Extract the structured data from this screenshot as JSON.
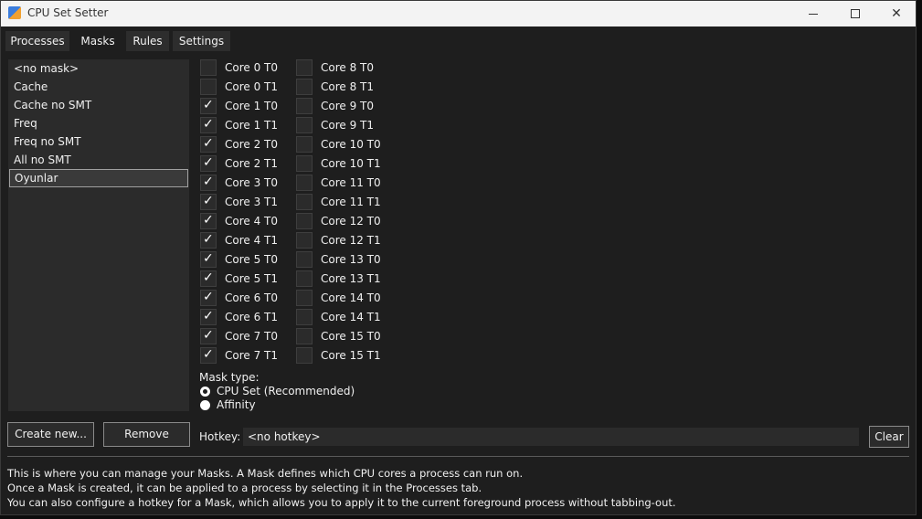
{
  "window": {
    "title": "CPU Set Setter"
  },
  "tabs": [
    "Processes",
    "Masks",
    "Rules",
    "Settings"
  ],
  "masks": [
    "<no mask>",
    "Cache",
    "Cache no SMT",
    "Freq",
    "Freq no SMT",
    "All no SMT",
    "Oyunlar"
  ],
  "selected_mask": "Oyunlar",
  "cores_left": [
    {
      "label": "Core 0 T0",
      "checked": false
    },
    {
      "label": "Core 0 T1",
      "checked": false
    },
    {
      "label": "Core 1 T0",
      "checked": true
    },
    {
      "label": "Core 1 T1",
      "checked": true
    },
    {
      "label": "Core 2 T0",
      "checked": true
    },
    {
      "label": "Core 2 T1",
      "checked": true
    },
    {
      "label": "Core 3 T0",
      "checked": true
    },
    {
      "label": "Core 3 T1",
      "checked": true
    },
    {
      "label": "Core 4 T0",
      "checked": true
    },
    {
      "label": "Core 4 T1",
      "checked": true
    },
    {
      "label": "Core 5 T0",
      "checked": true
    },
    {
      "label": "Core 5 T1",
      "checked": true
    },
    {
      "label": "Core 6 T0",
      "checked": true
    },
    {
      "label": "Core 6 T1",
      "checked": true
    },
    {
      "label": "Core 7 T0",
      "checked": true
    },
    {
      "label": "Core 7 T1",
      "checked": true
    }
  ],
  "cores_right": [
    {
      "label": "Core 8 T0",
      "checked": false
    },
    {
      "label": "Core 8 T1",
      "checked": false
    },
    {
      "label": "Core 9 T0",
      "checked": false
    },
    {
      "label": "Core 9 T1",
      "checked": false
    },
    {
      "label": "Core 10 T0",
      "checked": false
    },
    {
      "label": "Core 10 T1",
      "checked": false
    },
    {
      "label": "Core 11 T0",
      "checked": false
    },
    {
      "label": "Core 11 T1",
      "checked": false
    },
    {
      "label": "Core 12 T0",
      "checked": false
    },
    {
      "label": "Core 12 T1",
      "checked": false
    },
    {
      "label": "Core 13 T0",
      "checked": false
    },
    {
      "label": "Core 13 T1",
      "checked": false
    },
    {
      "label": "Core 14 T0",
      "checked": false
    },
    {
      "label": "Core 14 T1",
      "checked": false
    },
    {
      "label": "Core 15 T0",
      "checked": false
    },
    {
      "label": "Core 15 T1",
      "checked": false
    }
  ],
  "mask_type": {
    "label": "Mask type:",
    "options": [
      "CPU Set (Recommended)",
      "Affinity"
    ],
    "selected": "CPU Set (Recommended)"
  },
  "buttons": {
    "create": "Create new...",
    "remove": "Remove",
    "clear": "Clear"
  },
  "hotkey": {
    "label": "Hotkey:",
    "value": "<no hotkey>"
  },
  "info_lines": [
    "This is where you can manage your Masks. A Mask defines which CPU cores a process can run on.",
    "Once a Mask is created, it can be applied to a process by selecting it in the Processes tab.",
    "You can also configure a hotkey for a Mask, which allows you to apply it to the current foreground process without tabbing-out."
  ],
  "icons": {
    "app": "cpu-set-setter-app-icon",
    "check": "checkmark-icon"
  }
}
